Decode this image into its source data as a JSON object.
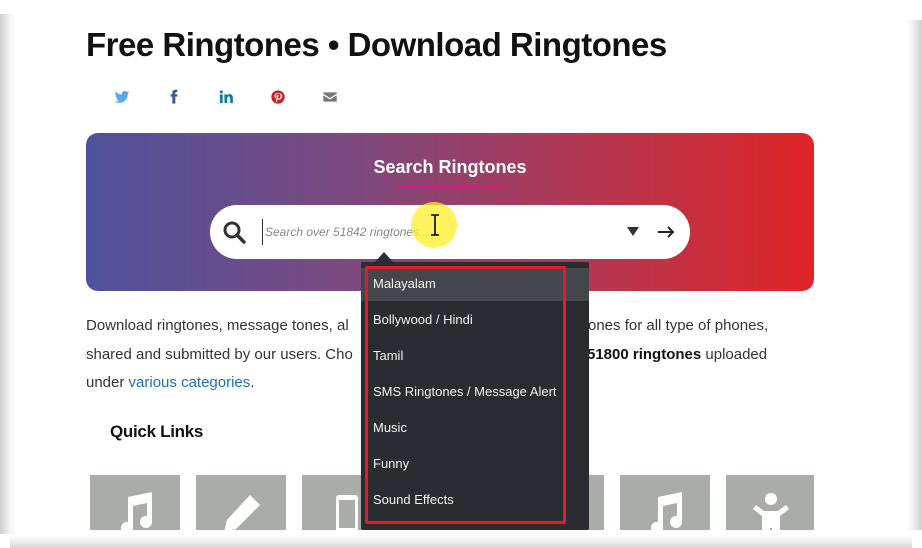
{
  "page": {
    "title": "Free Ringtones • Download Ringtones"
  },
  "share": {
    "icons": [
      "twitter-icon",
      "facebook-icon",
      "linkedin-icon",
      "pinterest-icon",
      "email-icon"
    ]
  },
  "hero": {
    "title": "Search Ringtones",
    "search_placeholder": "Search over 51842 ringtones..."
  },
  "intro": {
    "line1_left": "Download ringtones, message tones, al",
    "line1_right": "ones for all type of phones,",
    "line2_left": "shared and submitted by our users. Cho",
    "line2_bold": "51800 ringtones",
    "line2_right": " uploaded",
    "line3_prefix": "under ",
    "line3_link": "various categories",
    "line3_suffix": "."
  },
  "quick_links": {
    "heading": "Quick Links"
  },
  "dropdown": {
    "items": [
      "Malayalam",
      "Bollywood / Hindi",
      "Tamil",
      "SMS Ringtones / Message Alert",
      "Music",
      "Funny",
      "Sound Effects"
    ],
    "highlighted_index": 0
  },
  "colors": {
    "accent_underline": "#e0157d",
    "outline": "#e31b24",
    "link": "#1f6fb4",
    "gradient_start": "#4e529c",
    "gradient_end": "#df2527"
  }
}
